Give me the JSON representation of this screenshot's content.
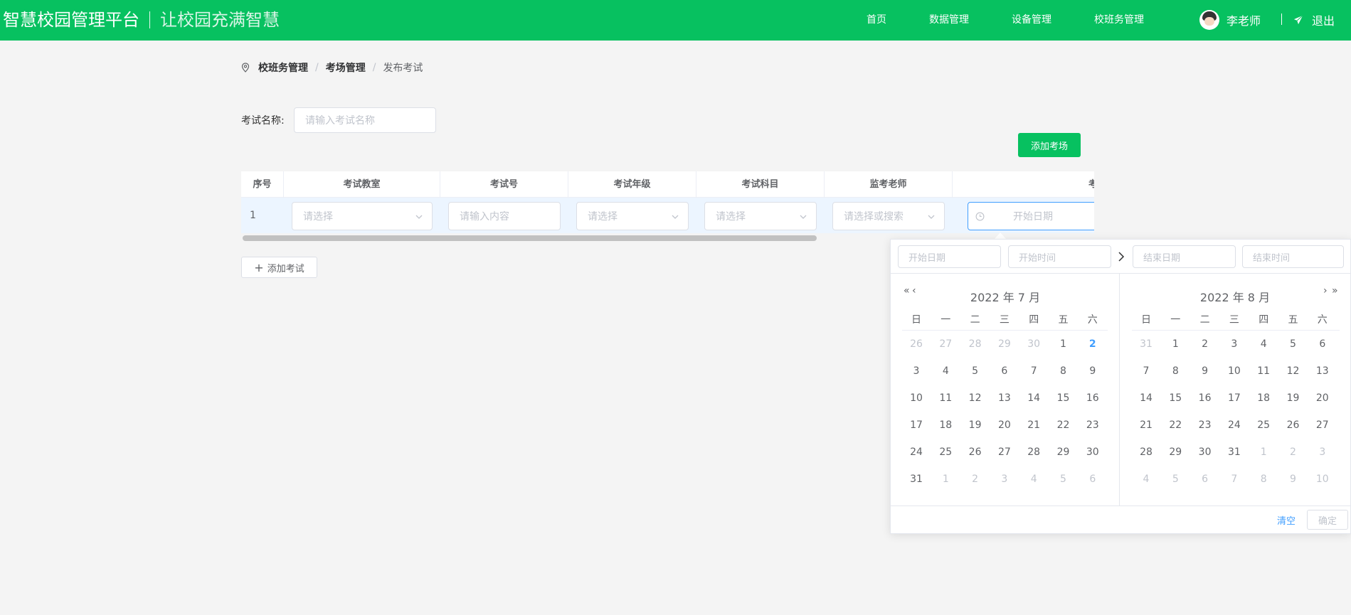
{
  "header": {
    "brand": "智慧校园管理平台",
    "slogan": "让校园充满智慧",
    "nav": [
      "首页",
      "数据管理",
      "设备管理",
      "校班务管理"
    ],
    "user_name": "李老师",
    "logout_label": "退出"
  },
  "breadcrumb": {
    "items": [
      "校班务管理",
      "考场管理",
      "发布考试"
    ],
    "separator": "/"
  },
  "form": {
    "exam_name_label": "考试名称:",
    "exam_name_placeholder": "请输入考试名称",
    "add_room_button": "添加考场",
    "add_exam_button": "添加考试"
  },
  "table": {
    "columns": [
      "序号",
      "考试教室",
      "考试号",
      "考试年级",
      "考试科目",
      "监考老师",
      "考"
    ],
    "row": {
      "index": "1",
      "classroom_placeholder": "请选择",
      "exam_no_placeholder": "请输入内容",
      "grade_placeholder": "请选择",
      "subject_placeholder": "请选择",
      "teacher_placeholder": "请选择或搜索",
      "date_placeholder": "开始日期"
    }
  },
  "datepicker": {
    "start_date_placeholder": "开始日期",
    "start_time_placeholder": "开始时间",
    "end_date_placeholder": "结束日期",
    "end_time_placeholder": "结束时间",
    "left_month": "2022 年 7 月",
    "right_month": "2022 年 8 月",
    "weekdays": [
      "日",
      "一",
      "二",
      "三",
      "四",
      "五",
      "六"
    ],
    "left_days": [
      [
        "26",
        "27",
        "28",
        "29",
        "30",
        "1",
        "2"
      ],
      [
        "3",
        "4",
        "5",
        "6",
        "7",
        "8",
        "9"
      ],
      [
        "10",
        "11",
        "12",
        "13",
        "14",
        "15",
        "16"
      ],
      [
        "17",
        "18",
        "19",
        "20",
        "21",
        "22",
        "23"
      ],
      [
        "24",
        "25",
        "26",
        "27",
        "28",
        "29",
        "30"
      ],
      [
        "31",
        "1",
        "2",
        "3",
        "4",
        "5",
        "6"
      ]
    ],
    "right_days": [
      [
        "31",
        "1",
        "2",
        "3",
        "4",
        "5",
        "6"
      ],
      [
        "7",
        "8",
        "9",
        "10",
        "11",
        "12",
        "13"
      ],
      [
        "14",
        "15",
        "16",
        "17",
        "18",
        "19",
        "20"
      ],
      [
        "21",
        "22",
        "23",
        "24",
        "25",
        "26",
        "27"
      ],
      [
        "28",
        "29",
        "30",
        "31",
        "1",
        "2",
        "3"
      ],
      [
        "4",
        "5",
        "6",
        "7",
        "8",
        "9",
        "10"
      ]
    ],
    "today": "2",
    "clear_label": "清空",
    "ok_label": "确定"
  },
  "colors": {
    "brand": "#07c160",
    "accent": "#409eff"
  }
}
